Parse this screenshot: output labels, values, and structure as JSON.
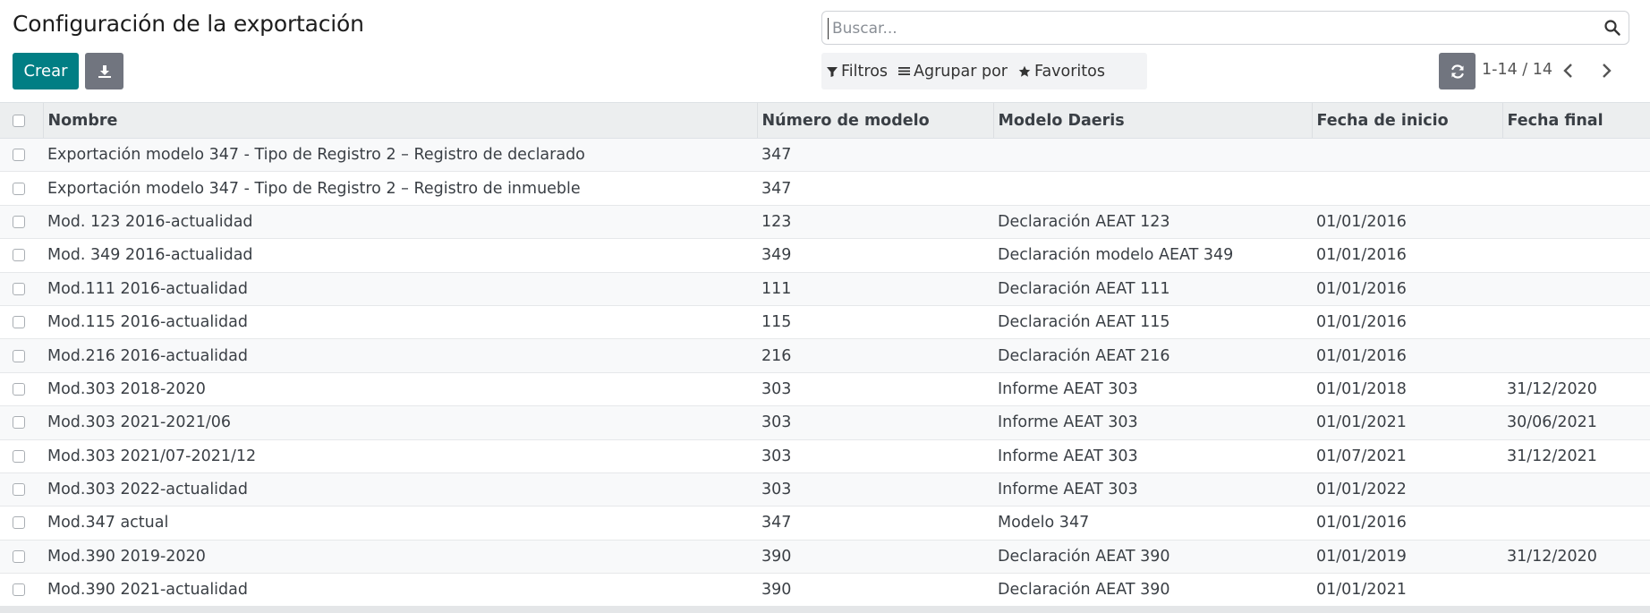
{
  "header": {
    "title": "Configuración de la exportación",
    "create_label": "Crear",
    "download_icon": "download-icon"
  },
  "search": {
    "placeholder": "Buscar...",
    "icon": "search-icon"
  },
  "filters": {
    "filters_label": "Filtros",
    "group_by_label": "Agrupar por",
    "favorites_label": "Favoritos"
  },
  "pager": {
    "value": "1-14 / 14",
    "refresh_icon": "refresh-icon",
    "prev_icon": "chevron-left-icon",
    "next_icon": "chevron-right-icon"
  },
  "table": {
    "columns": [
      "Nombre",
      "Número de modelo",
      "Modelo Daeris",
      "Fecha de inicio",
      "Fecha final"
    ],
    "rows": [
      [
        "Exportación modelo 347 - Tipo de Registro 2 – Registro de declarado",
        "347",
        "",
        "",
        ""
      ],
      [
        "Exportación modelo 347 - Tipo de Registro 2 – Registro de inmueble",
        "347",
        "",
        "",
        ""
      ],
      [
        "Mod. 123 2016-actualidad",
        "123",
        "Declaración AEAT 123",
        "01/01/2016",
        ""
      ],
      [
        "Mod. 349 2016-actualidad",
        "349",
        "Declaración modelo AEAT 349",
        "01/01/2016",
        ""
      ],
      [
        "Mod.111 2016-actualidad",
        "111",
        "Declaración AEAT 111",
        "01/01/2016",
        ""
      ],
      [
        "Mod.115 2016-actualidad",
        "115",
        "Declaración AEAT 115",
        "01/01/2016",
        ""
      ],
      [
        "Mod.216 2016-actualidad",
        "216",
        "Declaración AEAT 216",
        "01/01/2016",
        ""
      ],
      [
        "Mod.303 2018-2020",
        "303",
        "Informe AEAT 303",
        "01/01/2018",
        "31/12/2020"
      ],
      [
        "Mod.303 2021-2021/06",
        "303",
        "Informe AEAT 303",
        "01/01/2021",
        "30/06/2021"
      ],
      [
        "Mod.303 2021/07-2021/12",
        "303",
        "Informe AEAT 303",
        "01/07/2021",
        "31/12/2021"
      ],
      [
        "Mod.303 2022-actualidad",
        "303",
        "Informe AEAT 303",
        "01/01/2022",
        ""
      ],
      [
        "Mod.347 actual",
        "347",
        "Modelo 347",
        "01/01/2016",
        ""
      ],
      [
        "Mod.390 2019-2020",
        "390",
        "Declaración AEAT 390",
        "01/01/2019",
        "31/12/2020"
      ],
      [
        "Mod.390 2021-actualidad",
        "390",
        "Declaración AEAT 390",
        "01/01/2021",
        ""
      ]
    ]
  },
  "colors": {
    "primary": "#017e84",
    "secondary": "#71757f",
    "header_bg": "#eceeef"
  }
}
